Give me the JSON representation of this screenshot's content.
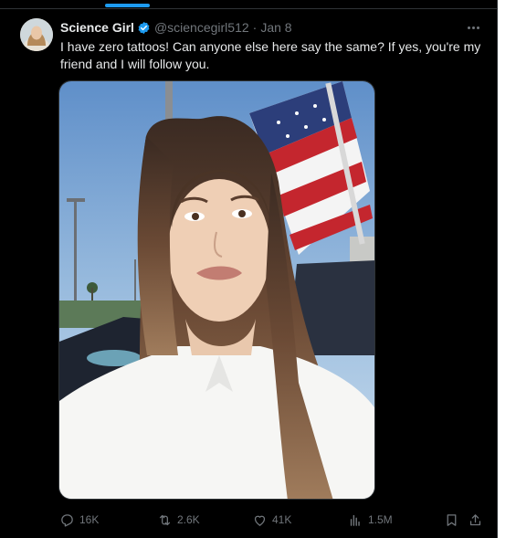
{
  "tweet": {
    "display_name": "Science Girl",
    "handle": "@sciencegirl512",
    "separator": "·",
    "date": "Jan 8",
    "text": "I have zero tattoos! Can anyone else here say the same? If yes, you're my friend and I will follow you.",
    "verified": true,
    "accent_color": "#1d9bf0"
  },
  "media": {
    "icon": "photo"
  },
  "actions": {
    "replies": "16K",
    "reposts": "2.6K",
    "likes": "41K",
    "views": "1.5M",
    "icons": [
      "reply-icon",
      "repost-icon",
      "like-icon",
      "views-icon",
      "bookmark-icon",
      "share-icon"
    ]
  }
}
